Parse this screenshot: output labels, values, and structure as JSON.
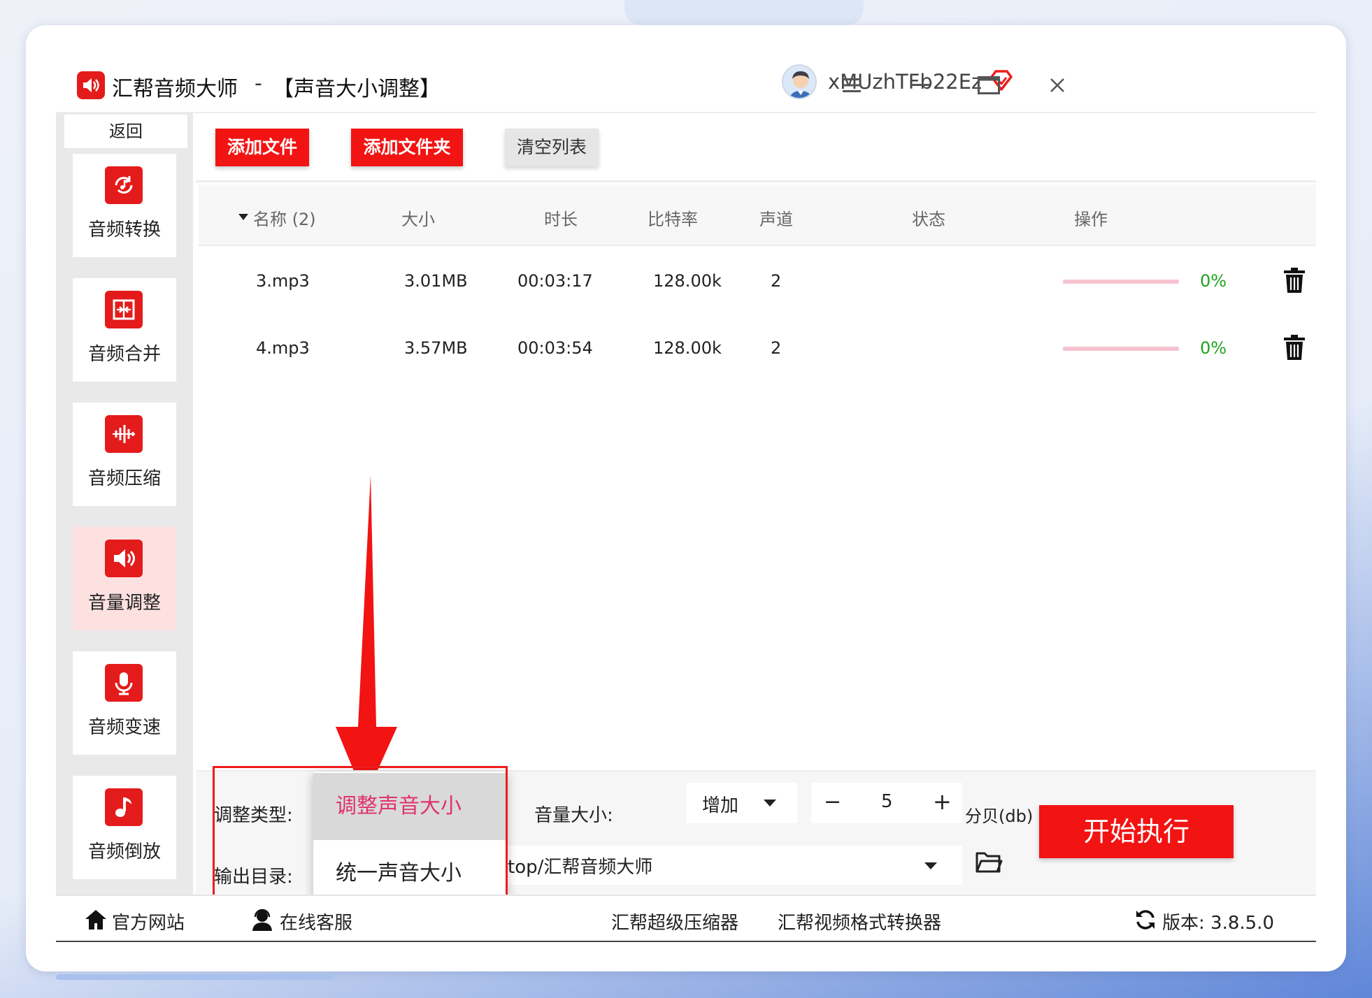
{
  "app": {
    "name": "汇帮音频大师",
    "separator": "-",
    "page_title": "【声音大小调整】"
  },
  "user": {
    "name": "xMUzhTFb22Ez"
  },
  "sidebar": {
    "back_label": "返回",
    "items": [
      {
        "label": "音频转换",
        "icon": "audio-convert-icon"
      },
      {
        "label": "音频合并",
        "icon": "audio-merge-icon"
      },
      {
        "label": "音频压缩",
        "icon": "audio-compress-icon"
      },
      {
        "label": "音量调整",
        "icon": "volume-icon",
        "active": true
      },
      {
        "label": "音频变速",
        "icon": "microphone-icon"
      },
      {
        "label": "音频倒放",
        "icon": "music-note-icon"
      }
    ]
  },
  "toolbar": {
    "add_file": "添加文件",
    "add_folder": "添加文件夹",
    "clear_list": "清空列表"
  },
  "table": {
    "headers": {
      "name": "名称 (2)",
      "size": "大小",
      "duration": "时长",
      "bitrate": "比特率",
      "channels": "声道",
      "status": "状态",
      "action": "操作"
    },
    "rows": [
      {
        "name": "3.mp3",
        "size": "3.01MB",
        "duration": "00:03:17",
        "bitrate": "128.00k",
        "channels": "2",
        "progress": 0,
        "percent": "0%"
      },
      {
        "name": "4.mp3",
        "size": "3.57MB",
        "duration": "00:03:54",
        "bitrate": "128.00k",
        "channels": "2",
        "progress": 0,
        "percent": "0%"
      }
    ]
  },
  "settings": {
    "type_label": "调整类型:",
    "volume_label": "音量大小:",
    "volume_mode": "增加",
    "step_minus": "−",
    "step_value": "5",
    "step_plus": "+",
    "unit": "分贝(db)",
    "output_label": "输出目录:",
    "output_path_visible": "top/汇帮音频大师",
    "start_button": "开始执行"
  },
  "dropdown": {
    "options": [
      "调整声音大小",
      "统一声音大小"
    ],
    "selected": "调整声音大小"
  },
  "footer": {
    "website": "官方网站",
    "support": "在线客服",
    "link1": "汇帮超级压缩器",
    "link2": "汇帮视频格式转换器",
    "version": "版本: 3.8.5.0"
  },
  "colors": {
    "accent": "#f21313",
    "selected_text": "#e0336b",
    "percent": "#1fa31f",
    "progress_track": "#f6c3d1"
  }
}
